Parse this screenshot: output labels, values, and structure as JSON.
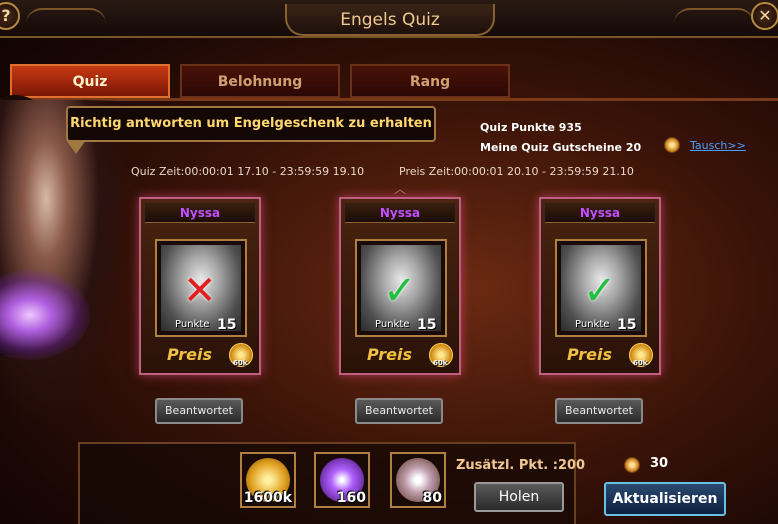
{
  "window": {
    "title": "Engels Quiz"
  },
  "tabs": [
    {
      "label": "Quiz",
      "active": true
    },
    {
      "label": "Belohnung",
      "active": false
    },
    {
      "label": "Rang",
      "active": false
    }
  ],
  "bubble": {
    "text": "Richtig antworten um Engelgeschenk zu erhalten"
  },
  "stats": {
    "quiz_punkte": "Quiz Punkte 935",
    "gutscheine": "Meine Quiz Gutscheine 20",
    "tausch_link": "Tausch>>"
  },
  "times": {
    "quiz": "Quiz Zeit:00:00:01 17.10  - 23:59:59 19.10",
    "preis": "Preis Zeit:00:00:01 20.10  - 23:59:59 21.10"
  },
  "cards": [
    {
      "name": "Nyssa",
      "result": "wrong",
      "mark": "✕",
      "punkte_label": "Punkte",
      "punkte": "15",
      "preis_label": "Preis",
      "coin": "60k",
      "button": "Beantwortet"
    },
    {
      "name": "Nyssa",
      "result": "right",
      "mark": "✓",
      "punkte_label": "Punkte",
      "punkte": "15",
      "preis_label": "Preis",
      "coin": "60k",
      "button": "Beantwortet"
    },
    {
      "name": "Nyssa",
      "result": "right",
      "mark": "✓",
      "punkte_label": "Punkte",
      "punkte": "15",
      "preis_label": "Preis",
      "coin": "60k",
      "button": "Beantwortet"
    }
  ],
  "rewards": [
    {
      "icon": "gold-coin-icon",
      "count": "1600k"
    },
    {
      "icon": "purple-orb-icon",
      "count": "160"
    },
    {
      "icon": "pearl-icon",
      "count": "80"
    }
  ],
  "bottom": {
    "extra_label": "Zusätzl. Pkt. :200",
    "holen": "Holen",
    "refresh_count": "30",
    "refresh_button": "Aktualisieren"
  },
  "colors": {
    "accent": "#c83a12",
    "card_glow": "#c06080",
    "link": "#4aa0ff",
    "name": "#c050ff"
  }
}
